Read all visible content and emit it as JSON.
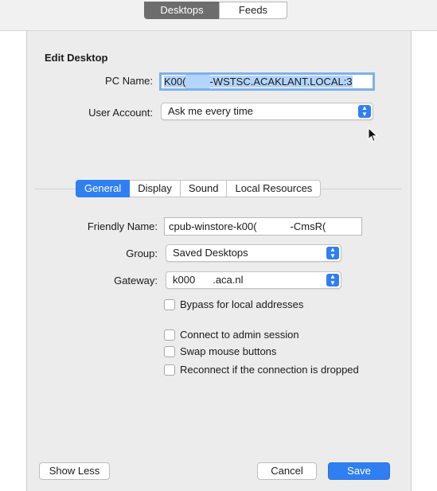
{
  "top_segments": {
    "desktops": "Desktops",
    "feeds": "Feeds"
  },
  "sheet": {
    "heading": "Edit Desktop",
    "pc_name": {
      "label": "PC Name:",
      "value_prefix": "K00(",
      "value_suffix": "-WSTSC.ACAKLANT.LOCAL:3"
    },
    "user_account": {
      "label": "User Account:",
      "value": "Ask me every time"
    },
    "tabs": [
      "General",
      "Display",
      "Sound",
      "Local Resources"
    ],
    "active_tab": "General",
    "general": {
      "friendly_name": {
        "label": "Friendly Name:",
        "value_prefix": "cpub-winstore-k00(",
        "value_suffix": "-CmsR("
      },
      "group": {
        "label": "Group:",
        "value": "Saved Desktops"
      },
      "gateway": {
        "label": "Gateway:",
        "value_prefix": "k000",
        "value_suffix": ".aca.nl"
      },
      "checkboxes": {
        "bypass": "Bypass for local addresses",
        "admin": "Connect to admin session",
        "swap": "Swap mouse buttons",
        "reconnect": "Reconnect if the connection is dropped"
      }
    },
    "buttons": {
      "show_less": "Show Less",
      "cancel": "Cancel",
      "save": "Save"
    }
  },
  "colors": {
    "accent": "#2f7ff2",
    "selection": "#b3d5fb",
    "sheet_bg": "#ececec"
  }
}
